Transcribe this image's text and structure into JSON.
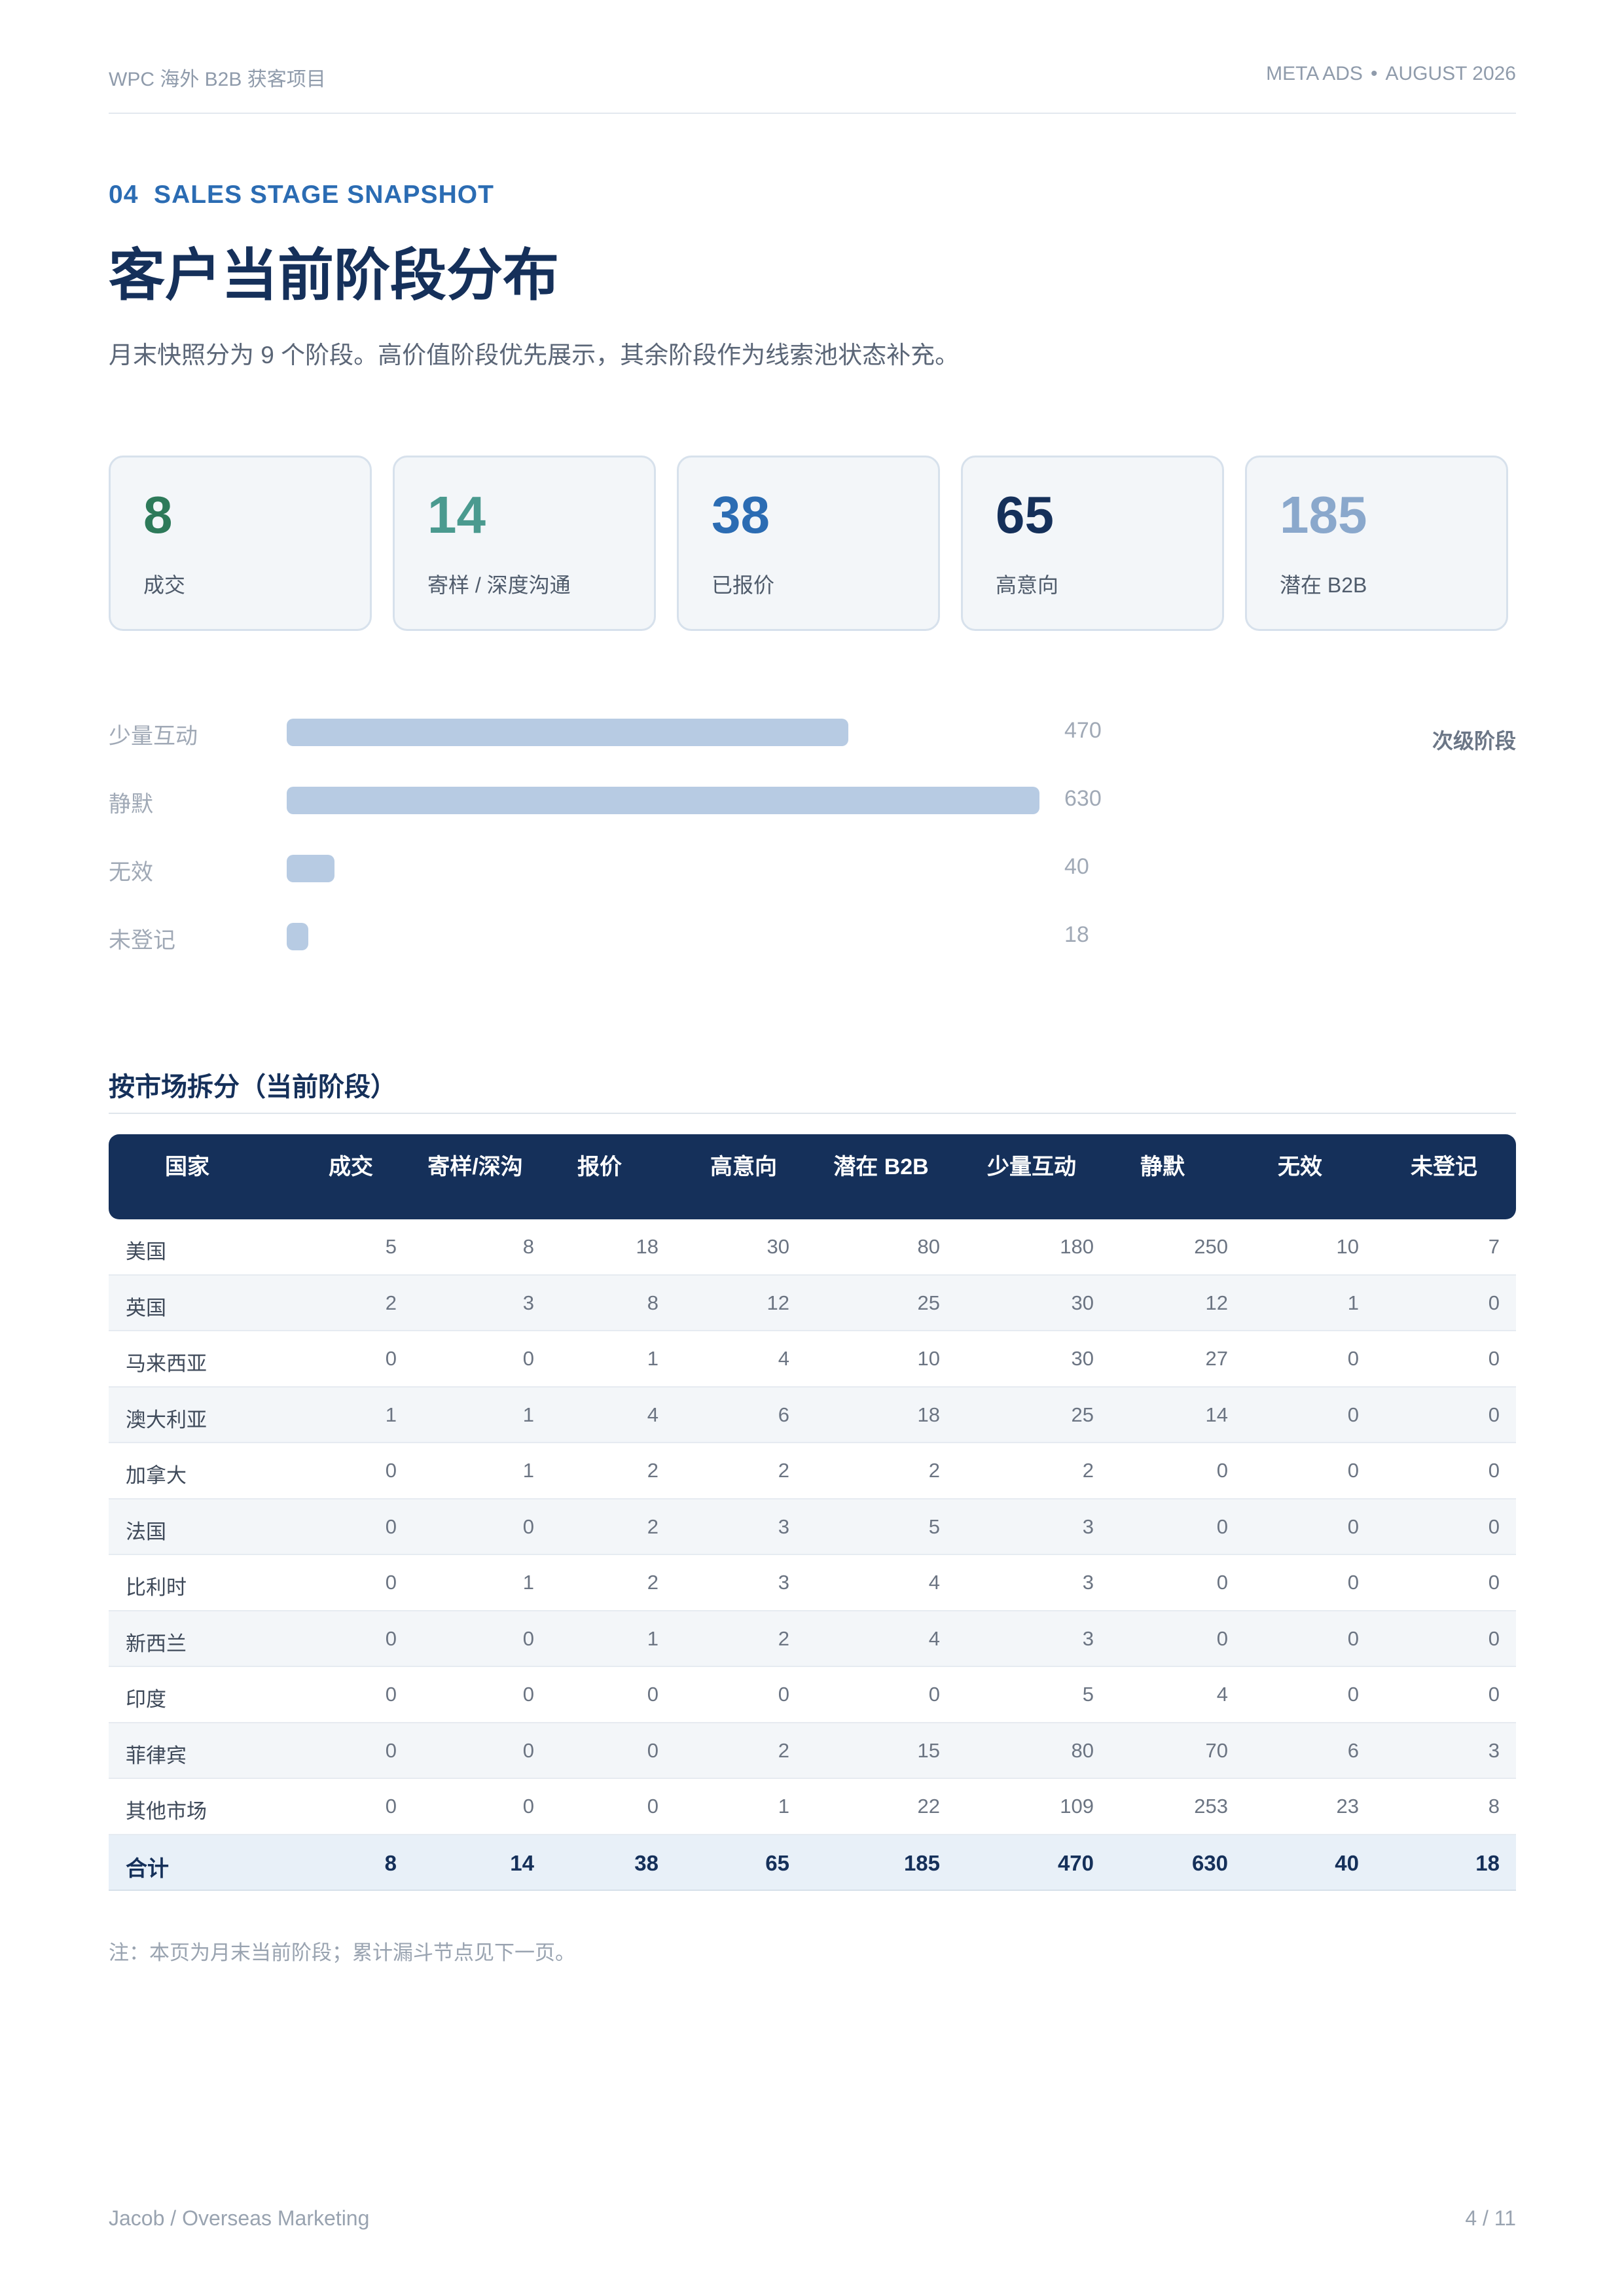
{
  "header": {
    "left": "WPC 海外 B2B 获客项目",
    "right_a": "META ADS",
    "right_sep": "•",
    "right_b": "AUGUST 2026"
  },
  "section": {
    "eyebrow": "04  SALES STAGE SNAPSHOT",
    "title": "客户当前阶段分布",
    "subtitle": "月末快照分为 9 个阶段。高价值阶段优先展示，其余阶段作为线索池状态补充。"
  },
  "cards": [
    {
      "value": "8",
      "label": "成交",
      "color": "#2d7a5a"
    },
    {
      "value": "14",
      "label": "寄样 / 深度沟通",
      "color": "#4a9a8f"
    },
    {
      "value": "38",
      "label": "已报价",
      "color": "#2b6cb3"
    },
    {
      "value": "65",
      "label": "高意向",
      "color": "#15305a"
    },
    {
      "value": "185",
      "label": "潜在 B2B",
      "color": "#8aa8cc"
    }
  ],
  "secondary": {
    "side_label": "次级阶段",
    "max": 630,
    "items": [
      {
        "label": "少量互动",
        "value": 470
      },
      {
        "label": "静默",
        "value": 630
      },
      {
        "label": "无效",
        "value": 40
      },
      {
        "label": "未登记",
        "value": 18
      }
    ]
  },
  "market": {
    "title": "按市场拆分（当前阶段）",
    "columns": [
      "国家",
      "成交",
      "寄样/深沟",
      "报价",
      "高意向",
      "潜在 B2B",
      "少量互动",
      "静默",
      "无效",
      "未登记"
    ],
    "rows": [
      {
        "name": "美国",
        "values": [
          "5",
          "8",
          "18",
          "30",
          "80",
          "180",
          "250",
          "10",
          "7"
        ]
      },
      {
        "name": "英国",
        "values": [
          "2",
          "3",
          "8",
          "12",
          "25",
          "30",
          "12",
          "1",
          "0"
        ]
      },
      {
        "name": "马来西亚",
        "values": [
          "0",
          "0",
          "1",
          "4",
          "10",
          "30",
          "27",
          "0",
          "0"
        ]
      },
      {
        "name": "澳大利亚",
        "values": [
          "1",
          "1",
          "4",
          "6",
          "18",
          "25",
          "14",
          "0",
          "0"
        ]
      },
      {
        "name": "加拿大",
        "values": [
          "0",
          "1",
          "2",
          "2",
          "2",
          "2",
          "0",
          "0",
          "0"
        ]
      },
      {
        "name": "法国",
        "values": [
          "0",
          "0",
          "2",
          "3",
          "5",
          "3",
          "0",
          "0",
          "0"
        ]
      },
      {
        "name": "比利时",
        "values": [
          "0",
          "1",
          "2",
          "3",
          "4",
          "3",
          "0",
          "0",
          "0"
        ]
      },
      {
        "name": "新西兰",
        "values": [
          "0",
          "0",
          "1",
          "2",
          "4",
          "3",
          "0",
          "0",
          "0"
        ]
      },
      {
        "name": "印度",
        "values": [
          "0",
          "0",
          "0",
          "0",
          "0",
          "5",
          "4",
          "0",
          "0"
        ]
      },
      {
        "name": "菲律宾",
        "values": [
          "0",
          "0",
          "0",
          "2",
          "15",
          "80",
          "70",
          "6",
          "3"
        ]
      },
      {
        "name": "其他市场",
        "values": [
          "0",
          "0",
          "0",
          "1",
          "22",
          "109",
          "253",
          "23",
          "8"
        ]
      }
    ],
    "total": {
      "name": "合计",
      "values": [
        "8",
        "14",
        "38",
        "65",
        "185",
        "470",
        "630",
        "40",
        "18"
      ]
    }
  },
  "note": "注：本页为月末当前阶段；累计漏斗节点见下一页。",
  "footer": {
    "left": "Jacob / Overseas Marketing",
    "right": "4 / 11"
  }
}
